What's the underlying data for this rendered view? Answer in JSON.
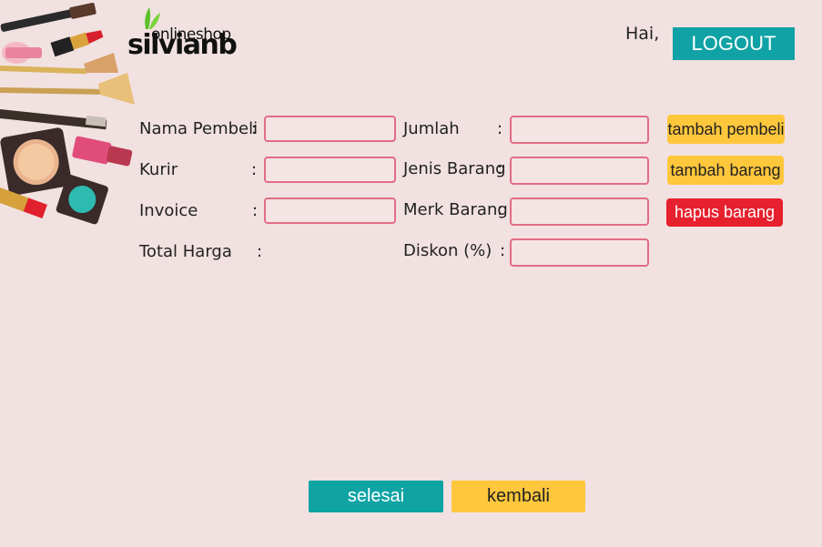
{
  "brand": {
    "top_text": "onlineshop",
    "main_text": "silvianb"
  },
  "header": {
    "greeting": "Hai,",
    "logout_label": "LOGOUT"
  },
  "form": {
    "left": [
      {
        "label": "Nama Pembeli",
        "colon": ":",
        "value": ""
      },
      {
        "label": "Kurir",
        "colon": ":",
        "value": ""
      },
      {
        "label": "Invoice",
        "colon": ":",
        "value": ""
      },
      {
        "label": "Total Harga",
        "colon": ":"
      }
    ],
    "right": [
      {
        "label": "Jumlah",
        "colon": ":",
        "value": ""
      },
      {
        "label": "Jenis Barang",
        "colon": ":",
        "value": ""
      },
      {
        "label": "Merk Barang",
        "colon": ":",
        "value": ""
      },
      {
        "label": "Diskon (%)",
        "colon": ":",
        "value": ""
      }
    ]
  },
  "actions": {
    "tambah_pembeli": "tambah pembeli",
    "tambah_barang": "tambah barang",
    "hapus_barang": "hapus barang"
  },
  "footer": {
    "selesai_label": "selesai",
    "kembali_label": "kembali"
  },
  "colors": {
    "background": "#f1e1e1",
    "accent_teal": "#10a2a5",
    "accent_yellow": "#ffc73c",
    "accent_red": "#e7202e",
    "field_border": "#e36c86"
  }
}
